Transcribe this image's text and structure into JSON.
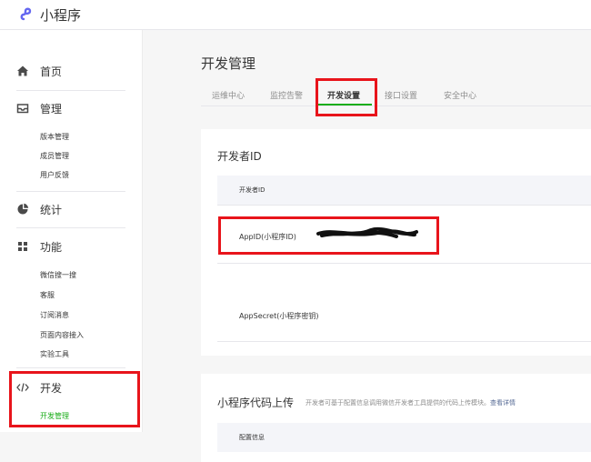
{
  "header": {
    "app_name": "小程序"
  },
  "sidebar": {
    "groups": [
      {
        "label": "首页",
        "icon": "home-icon",
        "items": []
      },
      {
        "label": "管理",
        "icon": "manage-icon",
        "items": [
          "版本管理",
          "成员管理",
          "用户反馈"
        ]
      },
      {
        "label": "统计",
        "icon": "stats-pie-icon",
        "items": []
      },
      {
        "label": "功能",
        "icon": "features-grid-icon",
        "items": [
          "微信搜一搜",
          "客服",
          "订阅消息",
          "页面内容接入",
          "实验工具"
        ]
      },
      {
        "label": "开发",
        "icon": "code-icon",
        "items": [
          "开发管理"
        ]
      }
    ],
    "active_item": "开发管理"
  },
  "main": {
    "title": "开发管理",
    "tabs": [
      "运维中心",
      "监控告警",
      "开发设置",
      "接口设置",
      "安全中心"
    ],
    "active_tab": "开发设置",
    "developer_id_card": {
      "title": "开发者ID",
      "table_header": "开发者ID",
      "rows": [
        "AppID(小程序ID)",
        "AppSecret(小程序密钥)"
      ]
    },
    "upload_card": {
      "title": "小程序代码上传",
      "description": "开发者可基于配置信息调用微信开发者工具提供的代码上传模块。",
      "link": "查看详情",
      "table_header": "配置信息"
    }
  },
  "colors": {
    "accent": "#1aad19",
    "highlight": "#e8141b",
    "link": "#576b95"
  }
}
